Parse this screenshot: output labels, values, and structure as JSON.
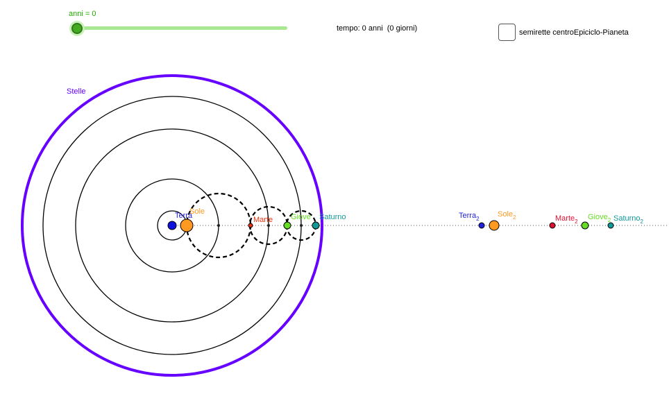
{
  "slider": {
    "label": "anni = 0",
    "value": 0
  },
  "time_text": "tempo: 0 anni  (0 giorni)",
  "checkbox": {
    "label": "semirette centroEpiciclo-Pianeta",
    "checked": false
  },
  "labels": {
    "stars": "Stelle",
    "terra": "Terra",
    "sole": "Sole",
    "marte": "Marte",
    "giove": "Giove",
    "saturno": "Saturno",
    "subscript": "2"
  },
  "colors": {
    "stars": "#6600ff",
    "terra": "#2222dd",
    "sole": "#ff9922",
    "marte": "#ee3311",
    "marte2": "#dd1133",
    "giove": "#66dd22",
    "saturno": "#119999",
    "slider": "#44aa22"
  }
}
